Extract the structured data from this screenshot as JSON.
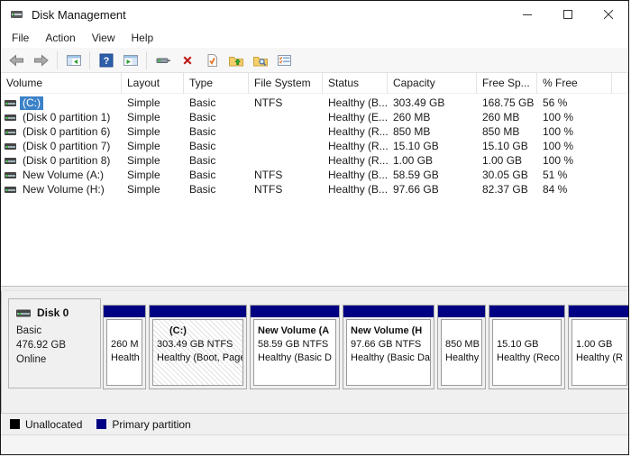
{
  "window": {
    "title": "Disk Management"
  },
  "menu": {
    "items": [
      "File",
      "Action",
      "View",
      "Help"
    ]
  },
  "toolbar": {
    "icons": [
      "back",
      "forward",
      "show-console-tree",
      "help",
      "show-action-pane",
      "rescan-disks",
      "delete-volume",
      "mark-partition-active",
      "open",
      "explore",
      "properties"
    ]
  },
  "volume_list": {
    "columns": [
      "Volume",
      "Layout",
      "Type",
      "File System",
      "Status",
      "Capacity",
      "Free Sp...",
      "% Free"
    ],
    "rows": [
      {
        "volume": "(C:)",
        "layout": "Simple",
        "type": "Basic",
        "fs": "NTFS",
        "status": "Healthy (B...",
        "capacity": "303.49 GB",
        "free": "168.75 GB",
        "pct": "56 %",
        "selected": true
      },
      {
        "volume": "(Disk 0 partition 1)",
        "layout": "Simple",
        "type": "Basic",
        "fs": "",
        "status": "Healthy (E...",
        "capacity": "260 MB",
        "free": "260 MB",
        "pct": "100 %",
        "selected": false
      },
      {
        "volume": "(Disk 0 partition 6)",
        "layout": "Simple",
        "type": "Basic",
        "fs": "",
        "status": "Healthy (R...",
        "capacity": "850 MB",
        "free": "850 MB",
        "pct": "100 %",
        "selected": false
      },
      {
        "volume": "(Disk 0 partition 7)",
        "layout": "Simple",
        "type": "Basic",
        "fs": "",
        "status": "Healthy (R...",
        "capacity": "15.10 GB",
        "free": "15.10 GB",
        "pct": "100 %",
        "selected": false
      },
      {
        "volume": "(Disk 0 partition 8)",
        "layout": "Simple",
        "type": "Basic",
        "fs": "",
        "status": "Healthy (R...",
        "capacity": "1.00 GB",
        "free": "1.00 GB",
        "pct": "100 %",
        "selected": false
      },
      {
        "volume": "New Volume (A:)",
        "layout": "Simple",
        "type": "Basic",
        "fs": "NTFS",
        "status": "Healthy (B...",
        "capacity": "58.59 GB",
        "free": "30.05 GB",
        "pct": "51 %",
        "selected": false
      },
      {
        "volume": "New Volume (H:)",
        "layout": "Simple",
        "type": "Basic",
        "fs": "NTFS",
        "status": "Healthy (B...",
        "capacity": "97.66 GB",
        "free": "82.37 GB",
        "pct": "84 %",
        "selected": false
      }
    ]
  },
  "disk_view": {
    "disk": {
      "name": "Disk 0",
      "type": "Basic",
      "size": "476.92 GB",
      "status": "Online"
    },
    "partitions": [
      {
        "line1": "",
        "line2": "260 M",
        "line3": "Health"
      },
      {
        "line1": "(C:)",
        "line2": "303.49 GB NTFS",
        "line3": "Healthy (Boot, Page"
      },
      {
        "line1": "New Volume (A",
        "line2": "58.59 GB NTFS",
        "line3": "Healthy (Basic D"
      },
      {
        "line1": "New Volume (H",
        "line2": "97.66 GB NTFS",
        "line3": "Healthy (Basic Da"
      },
      {
        "line1": "",
        "line2": "850 MB",
        "line3": "Healthy ("
      },
      {
        "line1": "",
        "line2": "15.10 GB",
        "line3": "Healthy (Reco"
      },
      {
        "line1": "",
        "line2": "1.00 GB",
        "line3": "Healthy (R"
      }
    ]
  },
  "legend": {
    "items": [
      {
        "label": "Unallocated",
        "color": "#000000"
      },
      {
        "label": "Primary partition",
        "color": "#000082"
      }
    ]
  },
  "colors": {
    "selection": "#3b82c8",
    "partition_bar": "#000082",
    "toolbar_bg": "#f7f7f7",
    "pane_bg": "#f0f0f0"
  }
}
